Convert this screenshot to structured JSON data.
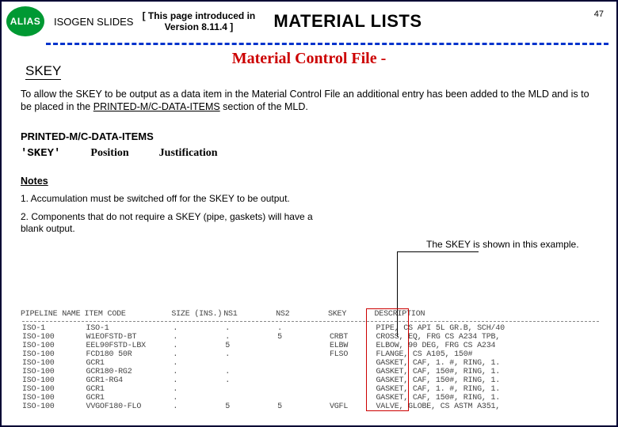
{
  "header": {
    "badge": "ALIAS",
    "brand": "ISOGEN SLIDES",
    "introduced_line1": "[ This page introduced in",
    "introduced_line2": "Version 8.11.4 ]",
    "title": "MATERIAL LISTS",
    "slidenum": "47"
  },
  "subtitle": "Material Control File -",
  "skey_label": "SKEY",
  "intro": {
    "prefix": "To allow the SKEY to be output as a data item in the Material Control File an additional entry has been added to the MLD and is to be placed in the ",
    "underlined": "PRINTED-M/C-DATA-ITEMS",
    "suffix": " section of the MLD."
  },
  "section": "PRINTED-M/C-DATA-ITEMS",
  "row": {
    "c1": "'SKEY'",
    "c2": "Position",
    "c3": "Justification"
  },
  "notes_heading": "Notes",
  "notes": [
    "1. Accumulation must be switched off for the SKEY to be output.",
    "2. Components that do not require a SKEY (pipe, gaskets) will have a blank output."
  ],
  "callout": "The SKEY is shown in this example.",
  "table": {
    "headers": [
      "PIPELINE NAME",
      "ITEM CODE",
      "SIZE (INS.)",
      "NS1",
      "NS2",
      "SKEY",
      "DESCRIPTION"
    ],
    "rows": [
      [
        "ISO-1",
        "ISO-1",
        ".",
        ".",
        ".",
        "",
        "PIPE, CS API 5L GR.B, SCH/40"
      ],
      [
        "ISO-100",
        "W1EOFSTD-BT",
        ".",
        ".",
        "5",
        "CRBT",
        "CROSS, EQ, FRG CS A234 TPB,"
      ],
      [
        "ISO-100",
        "EEL90FSTD-LBX",
        ".",
        "5",
        "",
        "ELBW",
        "ELBOW, 90 DEG, FRG CS A234"
      ],
      [
        "ISO-100",
        "FCD180 50R",
        ".",
        ".",
        "",
        "FLSO",
        "FLANGE, CS A105, 150#"
      ],
      [
        "ISO-100",
        "GCR1",
        ".",
        "",
        "",
        "",
        "GASKET, CAF, 1. #, RING, 1."
      ],
      [
        "ISO-100",
        "GCR180-RG2",
        ".",
        ".",
        "",
        "",
        "GASKET, CAF, 150#, RING, 1."
      ],
      [
        "ISO-100",
        "GCR1-RG4",
        ".",
        ".",
        "",
        "",
        "GASKET, CAF, 150#, RING, 1."
      ],
      [
        "ISO-100",
        "GCR1",
        ".",
        "",
        "",
        "",
        "GASKET, CAF, 1. #, RING, 1."
      ],
      [
        "ISO-100",
        "GCR1",
        ".",
        "",
        "",
        "",
        "GASKET, CAF, 150#, RING, 1."
      ],
      [
        "ISO-100",
        "VVGOF180-FLO",
        ".",
        "5",
        "5",
        "VGFL",
        "VALVE, GLOBE, CS ASTM A351,"
      ]
    ]
  }
}
